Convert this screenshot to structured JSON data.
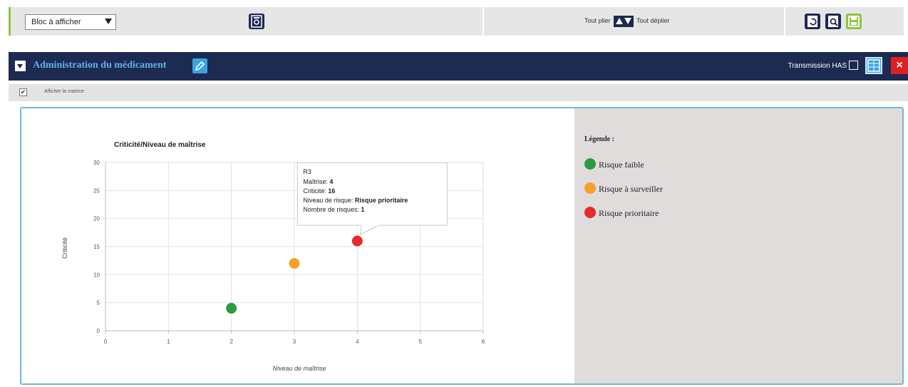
{
  "toolbar": {
    "bloc_select_value": "Bloc à afficher",
    "fold_all_label": "Tout plier",
    "unfold_all_label": "Tout déplier"
  },
  "section": {
    "title": "Administration du médicament",
    "transmission_label": "Transmission HAS",
    "close_label": "×"
  },
  "subbar": {
    "show_matrix_label": "Afficher la matrice"
  },
  "legend": {
    "title": "Légende :",
    "items": [
      {
        "label": "Risque faible",
        "color": "#2a9c3e"
      },
      {
        "label": "Risque à surveiller",
        "color": "#f5a12a"
      },
      {
        "label": "Risque prioritaire",
        "color": "#e52b2b"
      }
    ]
  },
  "chart_data": {
    "type": "scatter",
    "title": "Criticité/Niveau de maîtrise",
    "xlabel": "Niveau de maîtrise",
    "ylabel": "Criticité",
    "xlim": [
      0,
      6
    ],
    "ylim": [
      0,
      30
    ],
    "xticks": [
      0,
      1,
      2,
      3,
      4,
      5,
      6
    ],
    "yticks": [
      0,
      5,
      10,
      15,
      20,
      25,
      30
    ],
    "grid": true,
    "points": [
      {
        "x": 2,
        "y": 4,
        "color": "#2a9c3e"
      },
      {
        "x": 3,
        "y": 12,
        "color": "#f5a12a"
      },
      {
        "x": 4,
        "y": 16,
        "color": "#e52b2b"
      }
    ],
    "tooltip": {
      "title": "R3",
      "lines": [
        {
          "label": "Maîtrise: ",
          "value": "4"
        },
        {
          "label": "Criticité: ",
          "value": "16"
        },
        {
          "label": "Niveau de risque: ",
          "value": "Risque prioritaire"
        },
        {
          "label": "Nombre de risques: ",
          "value": "1"
        }
      ]
    }
  }
}
